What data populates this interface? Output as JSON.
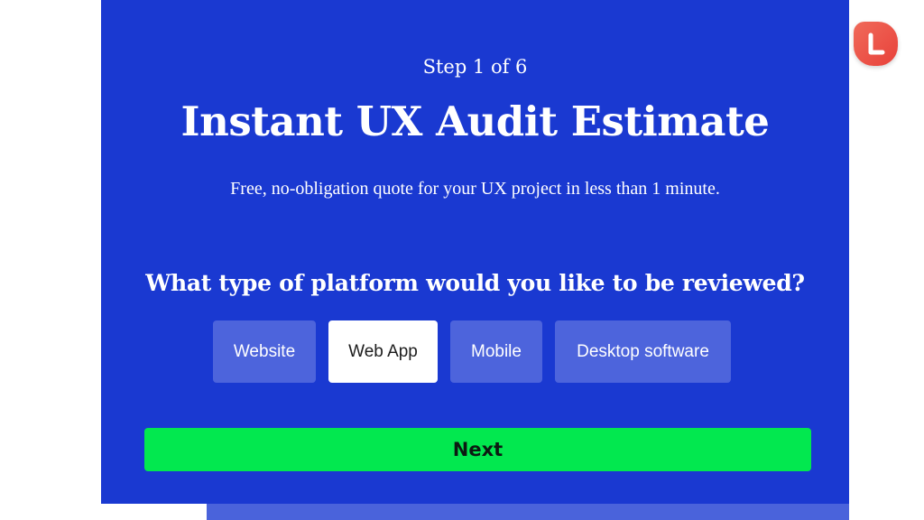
{
  "form": {
    "step_label": "Step 1 of 6",
    "title": "Instant UX Audit Estimate",
    "subtitle": "Free, no-obligation quote for your UX project in less than 1 minute.",
    "question": "What type of platform would you like to be reviewed?",
    "options": [
      {
        "label": "Website",
        "selected": false
      },
      {
        "label": "Web App",
        "selected": true
      },
      {
        "label": "Mobile",
        "selected": false
      },
      {
        "label": "Desktop software",
        "selected": false
      }
    ],
    "next_label": "Next",
    "progress_fraction": 0.1416
  },
  "logo": {
    "letter": "L",
    "icon": "logo-l-icon",
    "color": "#e94a3e"
  },
  "colors": {
    "panel_bg": "#1a39d1",
    "option_bg": "#4d64dc",
    "option_selected_bg": "#ffffff",
    "next_bg": "#02e84f"
  }
}
